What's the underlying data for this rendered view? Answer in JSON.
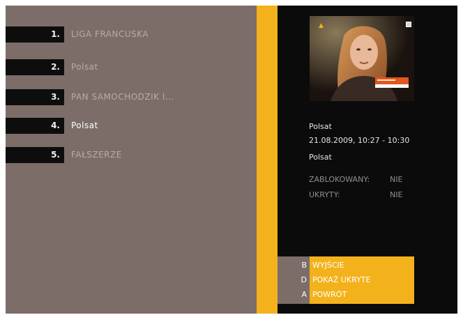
{
  "recordings": [
    {
      "number": "1.",
      "title": "LIGA FRANCUSKA",
      "selected": false
    },
    {
      "number": "2.",
      "title": "Polsat",
      "selected": false
    },
    {
      "number": "3.",
      "title": "PAN SAMOCHODZIK I...",
      "selected": false
    },
    {
      "number": "4.",
      "title": "Polsat",
      "selected": true
    },
    {
      "number": "5.",
      "title": "FAŁSZERZE",
      "selected": false
    }
  ],
  "details": {
    "channel": "Polsat",
    "datetime": "21.08.2009, 10:27 - 10:30",
    "title": "Polsat",
    "locked_label": "ZABLOKOWANY:",
    "locked_value": "NIE",
    "hidden_label": "UKRYTY:",
    "hidden_value": "NIE"
  },
  "preview": {
    "corner_left_icon": "triangle-indicator-icon",
    "corner_right_icon": "square-indicator-icon"
  },
  "keys": [
    {
      "key": "B",
      "label": "WYJŚCIE"
    },
    {
      "key": "D",
      "label": "POKAŻ UKRYTE"
    },
    {
      "key": "A",
      "label": "POWRÓT"
    }
  ],
  "colors": {
    "left_panel": "#7c6d68",
    "accent_yellow": "#f3b21b",
    "right_panel": "#0b0b0b"
  }
}
